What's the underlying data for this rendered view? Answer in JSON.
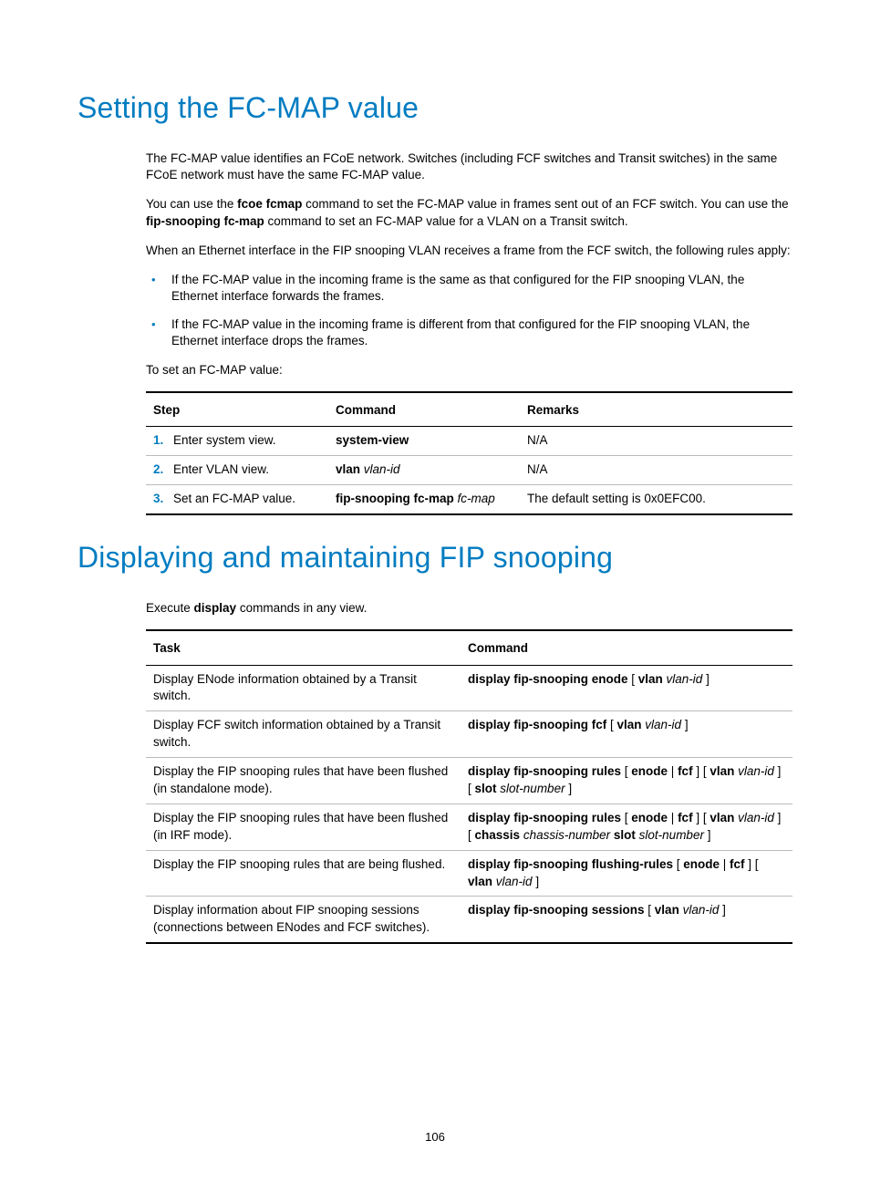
{
  "h1a": "Setting the FC-MAP value",
  "p1": "The FC-MAP value identifies an FCoE network. Switches (including FCF switches and Transit switches) in the same FCoE network must have the same FC-MAP value.",
  "p2a": "You can use the ",
  "p2b": "fcoe fcmap",
  "p2c": " command to set the FC-MAP value in frames sent out of an FCF switch. You can use the ",
  "p2d": "fip-snooping fc-map",
  "p2e": " command to set an FC-MAP value for a VLAN on a Transit switch.",
  "p3": "When an Ethernet interface in the FIP snooping VLAN receives a frame from the FCF switch, the following rules apply:",
  "b1": "If the FC-MAP value in the incoming frame is the same as that configured for the FIP snooping VLAN, the Ethernet interface forwards the frames.",
  "b2": "If the FC-MAP value in the incoming frame is different from that configured for the FIP snooping VLAN, the Ethernet interface drops the frames.",
  "p4": "To set an FC-MAP value:",
  "t1": {
    "h": {
      "c1": "Step",
      "c2": "Command",
      "c3": "Remarks"
    },
    "r1": {
      "n": "1.",
      "s": "Enter system view.",
      "cmd_b": "system-view",
      "rem": "N/A"
    },
    "r2": {
      "n": "2.",
      "s": "Enter VLAN view.",
      "cmd_b": "vlan",
      "cmd_i": " vlan-id",
      "rem": "N/A"
    },
    "r3": {
      "n": "3.",
      "s": "Set an FC-MAP value.",
      "cmd_b": "fip-snooping fc-map",
      "cmd_i": " fc-map",
      "rem": "The default setting is 0x0EFC00."
    }
  },
  "h1b": "Displaying and maintaining FIP snooping",
  "p5a": "Execute ",
  "p5b": "display",
  "p5c": " commands in any view.",
  "t2": {
    "h": {
      "c1": "Task",
      "c2": "Command"
    },
    "r1": {
      "task": "Display ENode information obtained by a Transit switch.",
      "cmd": [
        {
          "b": "display fip-snooping enode"
        },
        {
          "t": " [ "
        },
        {
          "b": "vlan"
        },
        {
          "t": " "
        },
        {
          "i": "vlan-id"
        },
        {
          "t": " ]"
        }
      ]
    },
    "r2": {
      "task": "Display FCF switch information obtained by a Transit switch.",
      "cmd": [
        {
          "b": "display fip-snooping fcf"
        },
        {
          "t": " [ "
        },
        {
          "b": "vlan"
        },
        {
          "t": " "
        },
        {
          "i": "vlan-id"
        },
        {
          "t": " ]"
        }
      ]
    },
    "r3": {
      "task": "Display the FIP snooping rules that have been flushed (in standalone mode).",
      "cmd": [
        {
          "b": "display fip-snooping rules"
        },
        {
          "t": " [ "
        },
        {
          "b": "enode"
        },
        {
          "t": " | "
        },
        {
          "b": "fcf"
        },
        {
          "t": " ] [ "
        },
        {
          "b": "vlan"
        },
        {
          "t": " "
        },
        {
          "i": "vlan-id"
        },
        {
          "t": " ] [ "
        },
        {
          "b": "slot"
        },
        {
          "t": " "
        },
        {
          "i": "slot-number"
        },
        {
          "t": " ]"
        }
      ]
    },
    "r4": {
      "task": "Display the FIP snooping rules that have been flushed (in IRF mode).",
      "cmd": [
        {
          "b": "display fip-snooping rules"
        },
        {
          "t": " [ "
        },
        {
          "b": "enode"
        },
        {
          "t": " | "
        },
        {
          "b": "fcf"
        },
        {
          "t": " ] [ "
        },
        {
          "b": "vlan"
        },
        {
          "t": " "
        },
        {
          "i": "vlan-id"
        },
        {
          "t": " ] [ "
        },
        {
          "b": "chassis"
        },
        {
          "t": " "
        },
        {
          "i": "chassis-number"
        },
        {
          "t": " "
        },
        {
          "b": "slot"
        },
        {
          "t": " "
        },
        {
          "i": "slot-number"
        },
        {
          "t": " ]"
        }
      ]
    },
    "r5": {
      "task": "Display the FIP snooping rules that are being flushed.",
      "cmd": [
        {
          "b": "display fip-snooping flushing-rules"
        },
        {
          "t": " [ "
        },
        {
          "b": "enode"
        },
        {
          "t": " | "
        },
        {
          "b": "fcf"
        },
        {
          "t": " ] [ "
        },
        {
          "b": "vlan"
        },
        {
          "t": " "
        },
        {
          "i": "vlan-id"
        },
        {
          "t": " ]"
        }
      ]
    },
    "r6": {
      "task": "Display information about FIP snooping sessions (connections between ENodes and FCF switches).",
      "cmd": [
        {
          "b": "display fip-snooping sessions"
        },
        {
          "t": " [ "
        },
        {
          "b": "vlan"
        },
        {
          "t": " "
        },
        {
          "i": "vlan-id"
        },
        {
          "t": " ]"
        }
      ]
    }
  },
  "pagenum": "106"
}
